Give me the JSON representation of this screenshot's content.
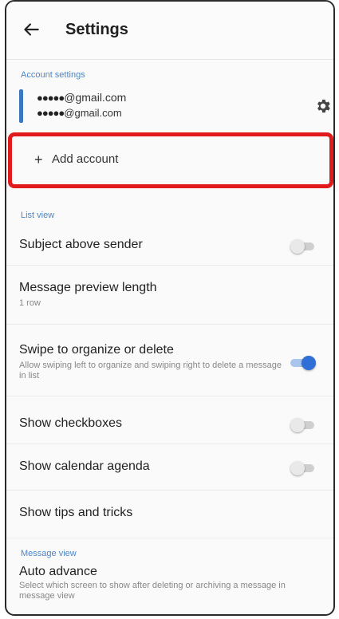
{
  "header": {
    "title": "Settings"
  },
  "account_settings": {
    "header": "Account settings",
    "account": {
      "name_masked": "●●●●●",
      "name_domain": "@gmail.com",
      "email_masked": "●●●●●",
      "email_domain": "@gmail.com"
    },
    "add_account_label": "Add account"
  },
  "list_view": {
    "header": "List view",
    "items": [
      {
        "label": "Subject above sender",
        "toggle": false
      },
      {
        "label": "Message preview length",
        "value": "1 row"
      },
      {
        "label": "Swipe to organize or delete",
        "description": "Allow swiping left to organize and swiping right to delete a message in list",
        "toggle": true
      },
      {
        "label": "Show checkboxes",
        "toggle": false
      },
      {
        "label": "Show calendar agenda",
        "toggle": false
      },
      {
        "label": "Show tips and tricks"
      }
    ]
  },
  "message_view": {
    "header": "Message view",
    "items": [
      {
        "label": "Auto advance",
        "description": "Select which screen to show after deleting or archiving a message in message view"
      }
    ]
  },
  "colors": {
    "accent": "#2f6fd6",
    "highlight_border": "#e11b1b"
  }
}
